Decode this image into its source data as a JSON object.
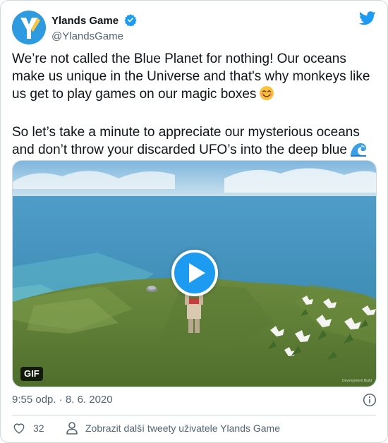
{
  "tweet": {
    "author": {
      "display_name": "Ylands Game",
      "handle": "@YlandsGame",
      "verified": true,
      "avatar_icon": "ylands-logo-icon"
    },
    "paragraphs": [
      {
        "text": "We’re not called the Blue Planet for nothing! Our oceans make us unique in the Universe and that's why monkeys like us get to play games on our magic boxes",
        "emoji": "smiling-face-icon"
      },
      {
        "text": "So let’s take a minute to appreciate our mysterious oceans and don’t throw your discarded UFO’s into the deep blue",
        "emoji": "water-wave-icon"
      }
    ],
    "media": {
      "badge": "GIF",
      "watermark": "Development Build",
      "play_icon": "play-icon"
    },
    "timestamp": "9:55 odp. · 8. 6. 2020",
    "likes": "32",
    "more_tweets_label": "Zobrazit další tweety uživatele Ylands Game"
  },
  "colors": {
    "accent": "#1d9bf0",
    "text": "#0f1419",
    "secondary_text": "#536471",
    "border": "#cfd9de",
    "like_icon": "#e0245e"
  }
}
